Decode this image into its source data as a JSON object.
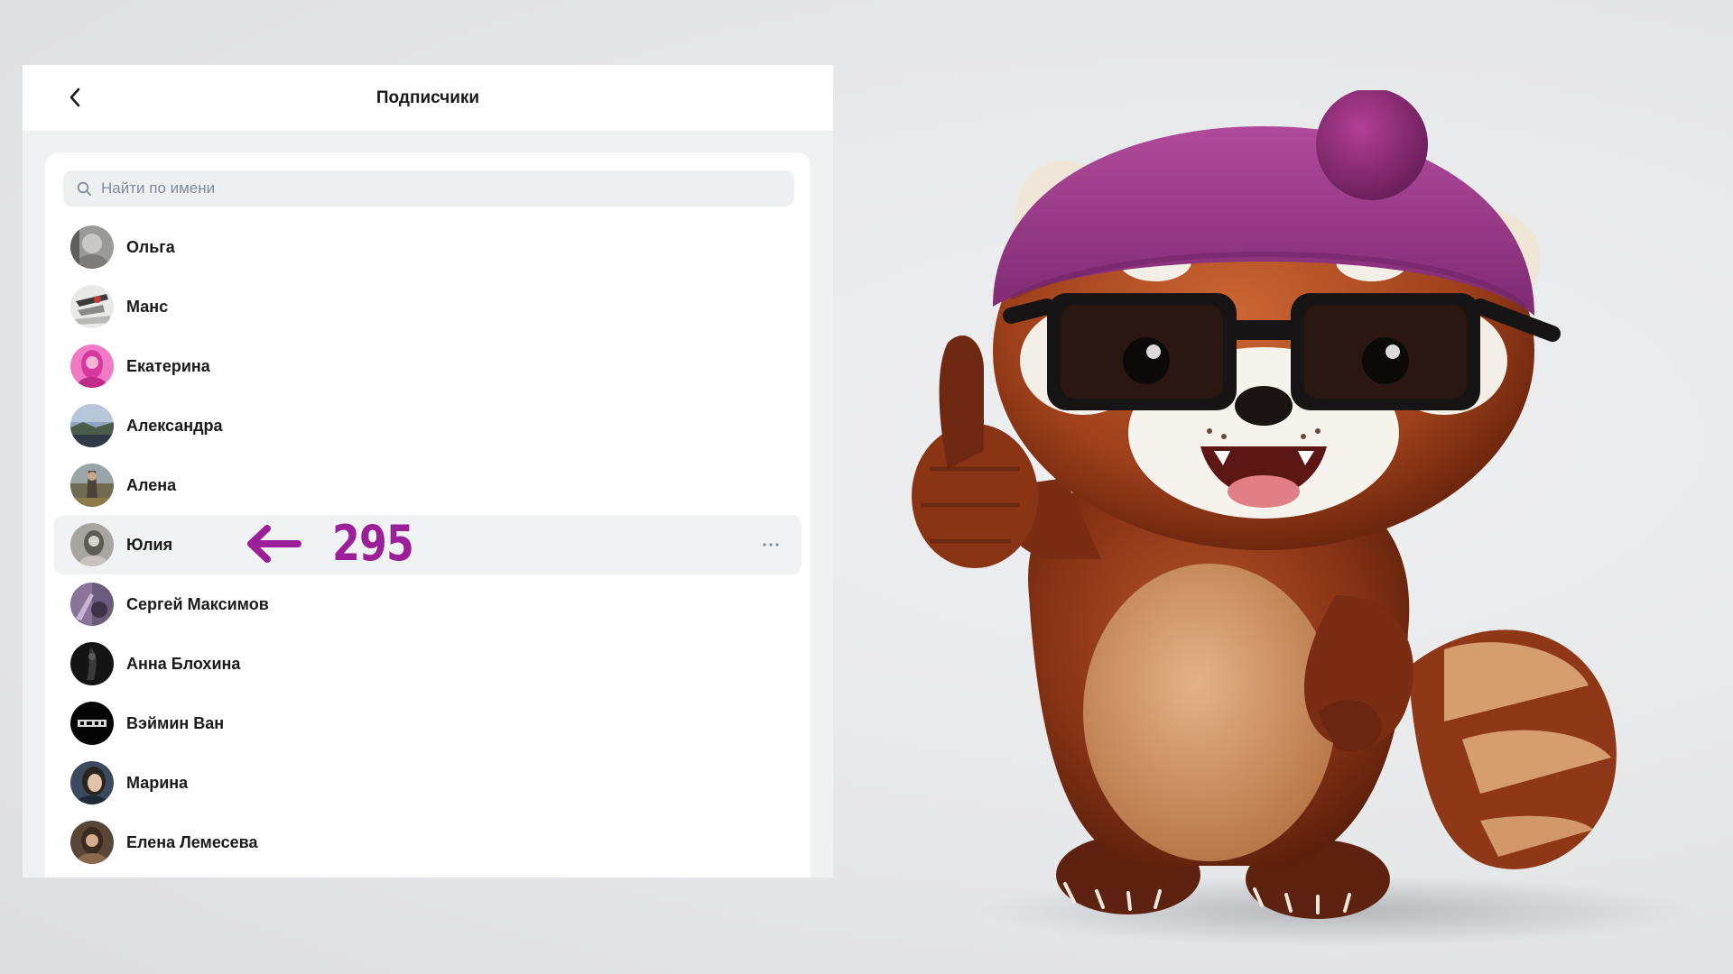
{
  "header": {
    "title": "Подписчики"
  },
  "search": {
    "placeholder": "Найти по имени"
  },
  "subscribers": [
    {
      "name": "Ольга"
    },
    {
      "name": "Манс"
    },
    {
      "name": "Екатерина"
    },
    {
      "name": "Александра"
    },
    {
      "name": "Алена"
    },
    {
      "name": "Юлия"
    },
    {
      "name": "Сергей Максимов"
    },
    {
      "name": "Анна Блохина"
    },
    {
      "name": "Вэймин Ван"
    },
    {
      "name": "Марина"
    },
    {
      "name": "Елена Лемесева"
    }
  ],
  "annotation": {
    "count": "295",
    "color": "#9b1f96"
  },
  "colors": {
    "accent": "#9b1f96",
    "text": "#1a1a1a",
    "muted": "#818c99"
  }
}
